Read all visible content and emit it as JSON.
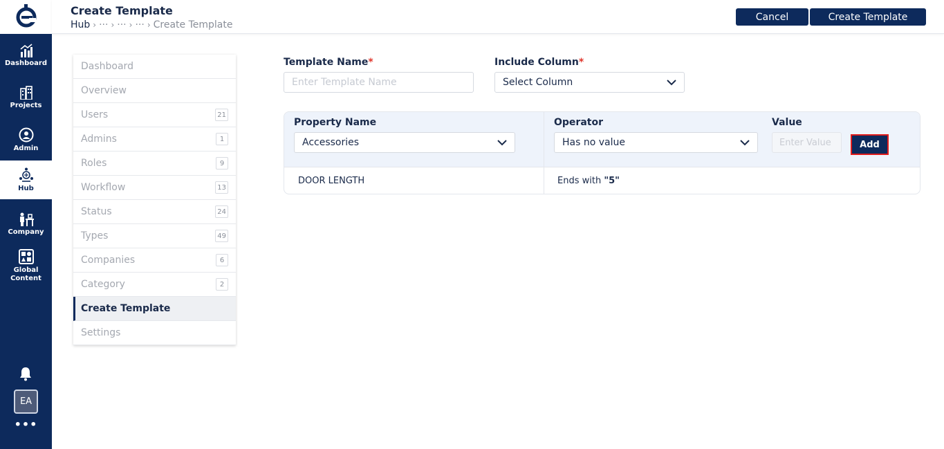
{
  "header": {
    "title": "Create Template",
    "breadcrumb": [
      "Hub",
      "···",
      "···",
      "···",
      "Create Template"
    ],
    "cancel_label": "Cancel",
    "create_label": "Create Template"
  },
  "rail": {
    "items": [
      {
        "label": "Dashboard",
        "icon": "dashboard-chart-icon"
      },
      {
        "label": "Projects",
        "icon": "buildings-icon"
      },
      {
        "label": "Admin",
        "icon": "admin-user-icon"
      },
      {
        "label": "Hub",
        "icon": "hub-icon"
      },
      {
        "label": "Company",
        "icon": "company-icon"
      },
      {
        "label": "Global Content",
        "icon": "global-content-icon"
      }
    ],
    "active": "Hub",
    "avatar_initials": "EA",
    "more": "•••"
  },
  "menu": {
    "items": [
      {
        "label": "Dashboard",
        "count": ""
      },
      {
        "label": "Overview",
        "count": ""
      },
      {
        "label": "Users",
        "count": "21"
      },
      {
        "label": "Admins",
        "count": "1"
      },
      {
        "label": "Roles",
        "count": "9"
      },
      {
        "label": "Workflow",
        "count": "13"
      },
      {
        "label": "Status",
        "count": "24"
      },
      {
        "label": "Types",
        "count": "49"
      },
      {
        "label": "Companies",
        "count": "6"
      },
      {
        "label": "Category",
        "count": "2"
      },
      {
        "label": "Create Template",
        "count": ""
      },
      {
        "label": "Settings",
        "count": ""
      }
    ],
    "active": "Create Template"
  },
  "form": {
    "template_name_label": "Template Name",
    "template_name_placeholder": "Enter Template Name",
    "include_column_label": "Include Column",
    "include_column_value": "Select Column",
    "required_mark": "*"
  },
  "conditions": {
    "property_label": "Property Name",
    "property_value": "Accessories",
    "operator_label": "Operator",
    "operator_value": "Has no value",
    "value_label": "Value",
    "value_placeholder": "Enter Value",
    "add_label": "Add",
    "rows": [
      {
        "property": "DOOR LENGTH",
        "condition_prefix": "Ends with",
        "condition_value": "\"5\""
      }
    ]
  },
  "colors": {
    "primary": "#0d2a5c",
    "highlight_border": "#e01b1b",
    "required": "#e0352b"
  }
}
